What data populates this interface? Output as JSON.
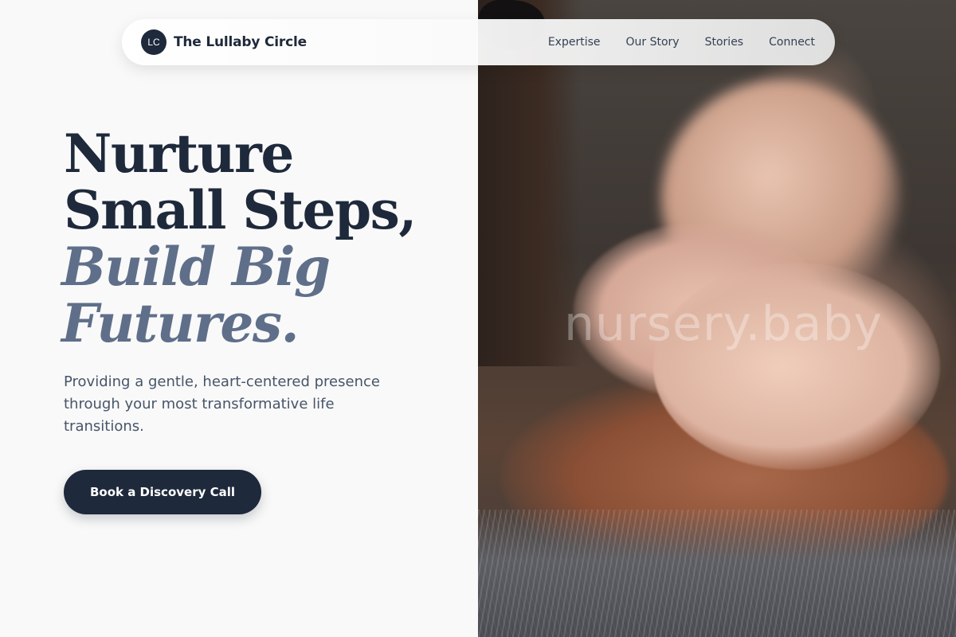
{
  "brand": {
    "initials": "LC",
    "name": "The Lullaby Circle"
  },
  "nav": {
    "links": [
      "Expertise",
      "Our Story",
      "Stories",
      "Connect"
    ]
  },
  "hero": {
    "headline_line1": "Nurture",
    "headline_line2": "Small Steps,",
    "headline_accent_line1": "Build Big",
    "headline_accent_line2": "Futures.",
    "subtext": "Providing a gentle, heart-centered presence through your most transformative life transitions.",
    "cta_label": "Book a Discovery Call"
  },
  "image": {
    "watermark": "nursery.baby"
  },
  "colors": {
    "primary": "#1e293b",
    "accent": "#5f6f8a",
    "body_text": "#475569",
    "background": "#f9f9f9"
  }
}
